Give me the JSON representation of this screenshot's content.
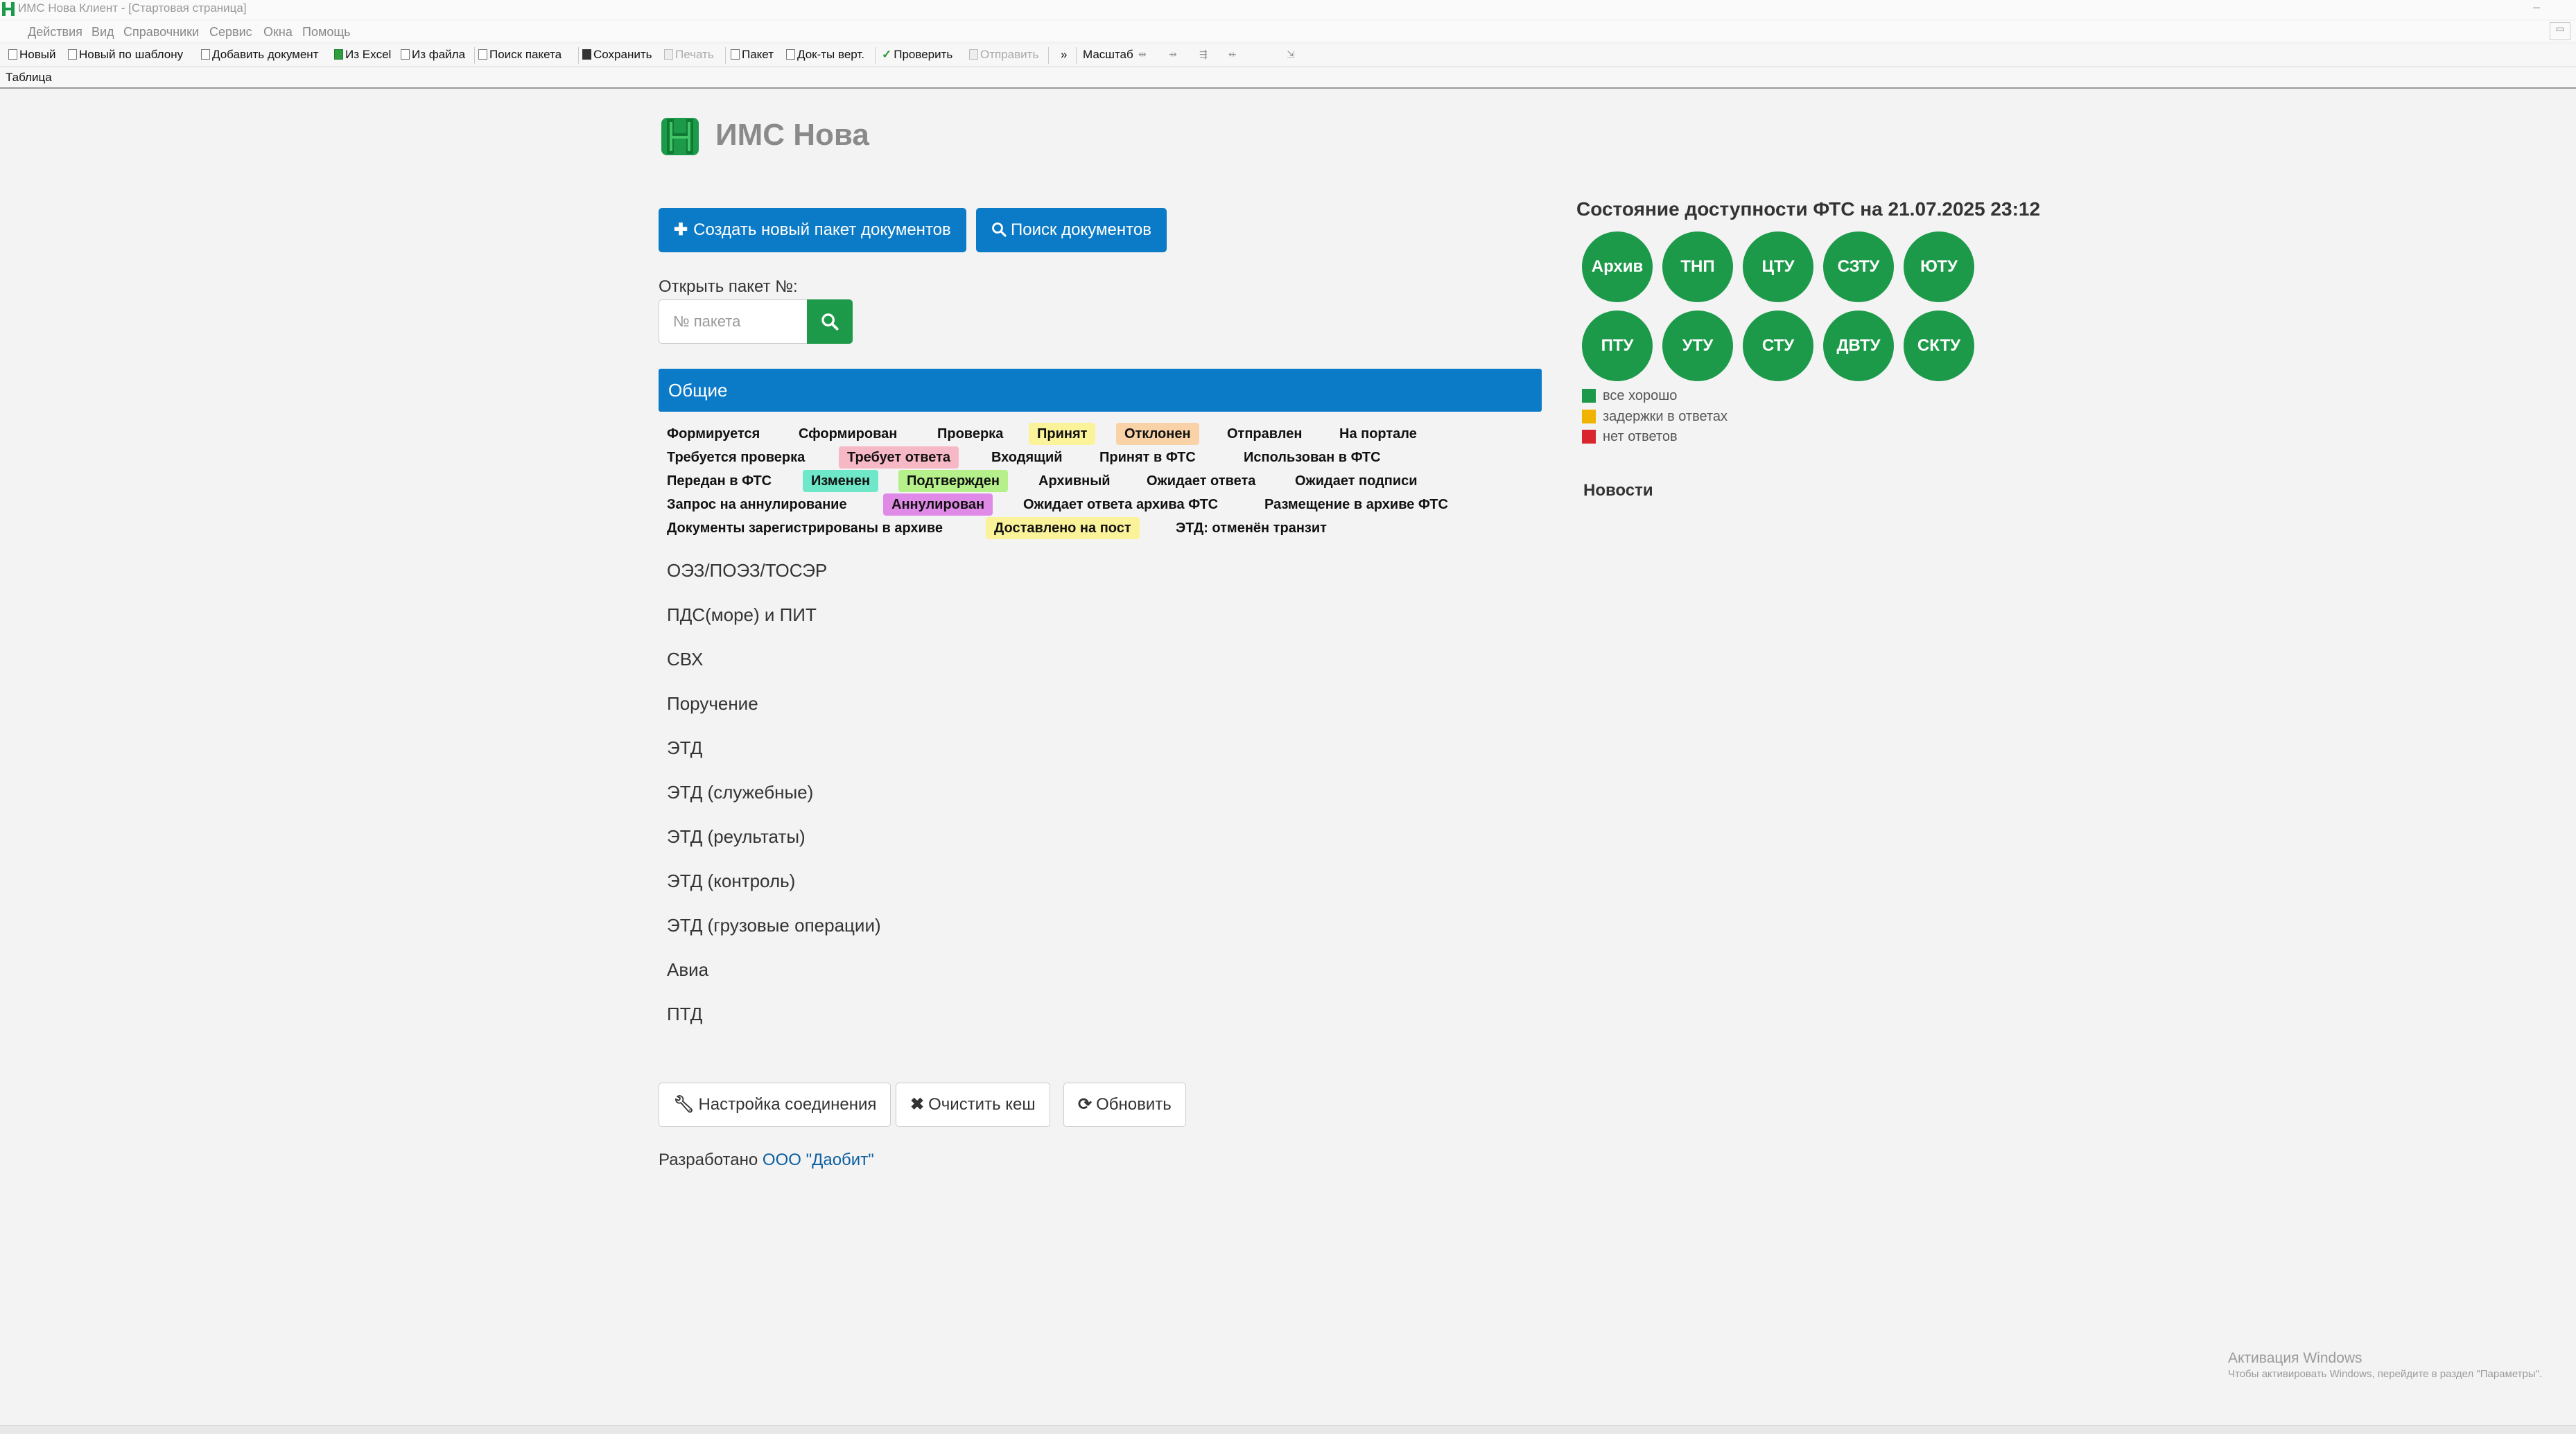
{
  "window": {
    "title": "ИМС Нова Клиент - [Стартовая страница]",
    "minimize_label": "–",
    "restore_label": "▭"
  },
  "menu": {
    "items": [
      "Действия",
      "Вид",
      "Справочники",
      "Сервис",
      "Окна",
      "Помощь"
    ]
  },
  "toolbar": {
    "new_label": "Новый",
    "new_template_label": "Новый по шаблону",
    "add_document_label": "Добавить документ",
    "from_excel_label": "Из Excel",
    "from_file_label": "Из файла",
    "search_package_label": "Поиск пакета",
    "save_label": "Сохранить",
    "print_label": "Печать",
    "package_label": "Пакет",
    "docs_vert_label": "Док-ты верт.",
    "check_label": "Проверить",
    "send_label": "Отправить",
    "more_label": "»",
    "scale_label": "Масштаб",
    "scale_icons": [
      "⇹",
      "⇸",
      "⇶",
      "⇷",
      "⇲"
    ]
  },
  "tabs": {
    "active": "Таблица"
  },
  "app": {
    "logo_text": "ИМС Нова",
    "brand_color": "#1c9a49",
    "accent_color": "#0b7ac7"
  },
  "actions": {
    "create_package": "Создать новый пакет документов",
    "search_documents": "Поиск документов"
  },
  "open_package": {
    "label": "Открыть пакет №:",
    "placeholder": "№ пакета"
  },
  "section": {
    "title": "Общие"
  },
  "statuses": [
    [
      {
        "label": "Формируется",
        "color": ""
      },
      {
        "label": "Сформирован",
        "color": ""
      },
      {
        "label": "Проверка",
        "color": ""
      },
      {
        "label": "Принят",
        "color": "#fbf39a"
      },
      {
        "label": "Отклонен",
        "color": "#f9d2a8"
      },
      {
        "label": "Отправлен",
        "color": ""
      },
      {
        "label": "На портале",
        "color": ""
      }
    ],
    [
      {
        "label": "Требуется проверка",
        "color": ""
      },
      {
        "label": "Требует ответа",
        "color": "#f7b8c6"
      },
      {
        "label": "Входящий",
        "color": ""
      },
      {
        "label": "Принят в ФТС",
        "color": ""
      },
      {
        "label": "Использован в ФТС",
        "color": ""
      }
    ],
    [
      {
        "label": "Передан в ФТС",
        "color": ""
      },
      {
        "label": "Изменен",
        "color": "#6ee8c8"
      },
      {
        "label": "Подтвержден",
        "color": "#b6f08a"
      },
      {
        "label": "Архивный",
        "color": ""
      },
      {
        "label": "Ожидает ответа",
        "color": ""
      },
      {
        "label": "Ожидает подписи",
        "color": ""
      }
    ],
    [
      {
        "label": "Запрос на аннулирование",
        "color": ""
      },
      {
        "label": "Аннулирован",
        "color": "#e08ae8"
      },
      {
        "label": "Ожидает ответа архива ФТС",
        "color": ""
      },
      {
        "label": "Размещение в архиве ФТС",
        "color": ""
      }
    ],
    [
      {
        "label": "Документы зарегистрированы в архиве",
        "color": ""
      },
      {
        "label": "Доставлено на пост",
        "color": "#fbf39a"
      },
      {
        "label": "ЭТД: отменён транзит",
        "color": ""
      }
    ]
  ],
  "categories": [
    "ОЭЗ/ПОЭЗ/ТОСЭР",
    "ПДС(море) и ПИТ",
    "СВХ",
    "Поручение",
    "ЭТД",
    "ЭТД (служебные)",
    "ЭТД (реультаты)",
    "ЭТД (контроль)",
    "ЭТД (грузовые операции)",
    "Авиа",
    "ПТД"
  ],
  "footer_buttons": {
    "connection_settings": "Настройка соединения",
    "clear_cache": "Очистить кеш",
    "refresh": "Обновить"
  },
  "developer": {
    "prefix": "Разработано",
    "company": "ООО \"Даобит\""
  },
  "fts": {
    "title": "Состояние доступности ФТС на 21.07.2025 23:12",
    "nodes": [
      {
        "label": "Архив",
        "status": "ok"
      },
      {
        "label": "ТНП",
        "status": "ok"
      },
      {
        "label": "ЦТУ",
        "status": "ok"
      },
      {
        "label": "СЗТУ",
        "status": "ok"
      },
      {
        "label": "ЮТУ",
        "status": "ok"
      },
      {
        "label": "ПТУ",
        "status": "ok"
      },
      {
        "label": "УТУ",
        "status": "ok"
      },
      {
        "label": "СТУ",
        "status": "ok"
      },
      {
        "label": "ДВТУ",
        "status": "ok"
      },
      {
        "label": "СКТУ",
        "status": "ok"
      }
    ],
    "legend": [
      {
        "label": "все хорошо",
        "color": "#1c9a49"
      },
      {
        "label": "задержки в ответах",
        "color": "#f0b400"
      },
      {
        "label": "нет ответов",
        "color": "#d9262c"
      }
    ]
  },
  "news": {
    "title": "Новости"
  },
  "watermark": {
    "title": "Активация Windows",
    "subtitle": "Чтобы активировать Windows, перейдите в раздел \"Параметры\"."
  }
}
